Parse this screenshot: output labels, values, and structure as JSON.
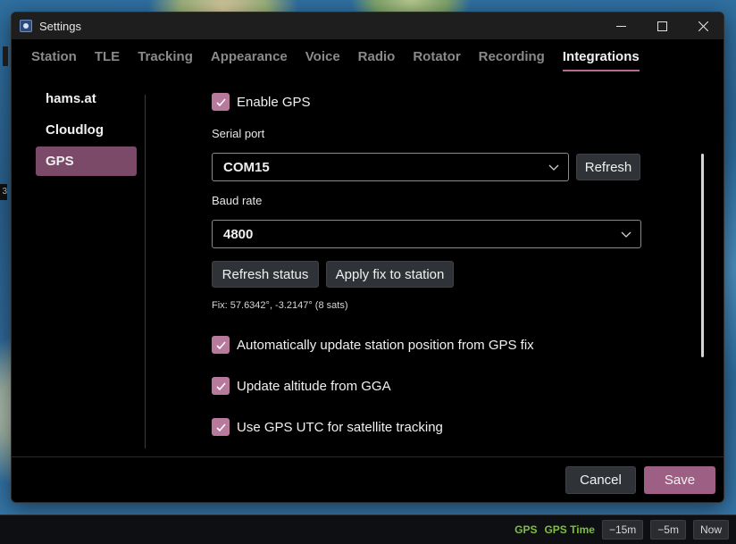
{
  "window": {
    "title": "Settings"
  },
  "tabs": [
    {
      "label": "Station",
      "active": false
    },
    {
      "label": "TLE",
      "active": false
    },
    {
      "label": "Tracking",
      "active": false
    },
    {
      "label": "Appearance",
      "active": false
    },
    {
      "label": "Voice",
      "active": false
    },
    {
      "label": "Radio",
      "active": false
    },
    {
      "label": "Rotator",
      "active": false
    },
    {
      "label": "Recording",
      "active": false
    },
    {
      "label": "Integrations",
      "active": true
    }
  ],
  "sidebar": {
    "items": [
      {
        "label": "hams.at",
        "active": false
      },
      {
        "label": "Cloudlog",
        "active": false
      },
      {
        "label": "GPS",
        "active": true
      }
    ]
  },
  "gps": {
    "enable_label": "Enable GPS",
    "enable_checked": true,
    "serial_port_label": "Serial port",
    "serial_port_value": "COM15",
    "refresh_label": "Refresh",
    "baud_rate_label": "Baud rate",
    "baud_rate_value": "4800",
    "refresh_status_label": "Refresh status",
    "apply_fix_label": "Apply fix to station",
    "fix_text": "Fix: 57.6342°, -3.2147° (8 sats)",
    "options": [
      {
        "label": "Automatically update station position from GPS fix",
        "checked": true
      },
      {
        "label": "Update altitude from GGA",
        "checked": true
      },
      {
        "label": "Use GPS UTC for satellite tracking",
        "checked": true
      }
    ]
  },
  "footer": {
    "cancel_label": "Cancel",
    "save_label": "Save"
  },
  "taskbar": {
    "gps_label": "GPS",
    "gps_time_label": "GPS Time",
    "minus15_label": "−15m",
    "minus5_label": "−5m",
    "now_label": "Now"
  },
  "colors": {
    "accent": "#b87a9c",
    "save": "#9e5f84",
    "nav_active": "#7a4a68",
    "status_green": "#7fbf3f"
  },
  "left_edge_tag": "3"
}
